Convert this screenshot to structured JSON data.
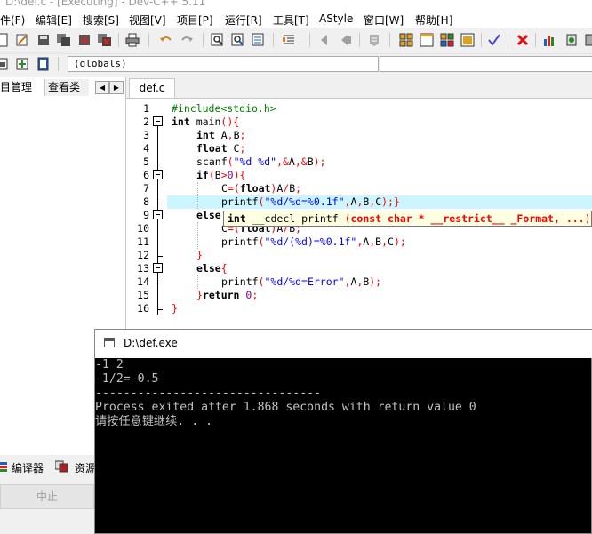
{
  "window": {
    "title": "D:\\def.c - [Executing] - Dev-C++ 5.11"
  },
  "menu": [
    "件(F)",
    "编辑[E]",
    "搜索[S]",
    "视图[V]",
    "项目[P]",
    "运行[R]",
    "工具[T]",
    "AStyle",
    "窗口[W]",
    "帮助[H]"
  ],
  "scope": {
    "value": "(globals)"
  },
  "left_panel": {
    "tab_project": "目管理",
    "tab_classes": "查看类",
    "prev": "◀",
    "next": "▶"
  },
  "bottom": {
    "tab_compiler": "编译器",
    "tab_resources": "资源",
    "abort_label": "中止"
  },
  "editor": {
    "tab": "def.c",
    "line_numbers": [
      "1",
      "2",
      "3",
      "4",
      "5",
      "6",
      "7",
      "8",
      "9",
      "10",
      "11",
      "12",
      "13",
      "14",
      "15",
      "16"
    ],
    "tooltip": "int __cdecl printf (const char * __restrict__ _Format, ...)",
    "tooltip_parts": {
      "ret": "int",
      "name": " __cdecl printf ",
      "open": "(",
      "args": "const char * __restrict__ _Format, ...",
      "close": ")"
    },
    "code": {
      "l1": "#include<stdio.h>",
      "l2a": "int",
      "l2b": " main",
      "l2c": "(){",
      "l3a": "int",
      "l3b": " A",
      "l3c": ",",
      "l3d": "B",
      "l3e": ";",
      "l4a": "float",
      "l4b": " C",
      "l4c": ";",
      "l5a": "scanf",
      "l5b": "(",
      "l5c": "\"%d %d\"",
      "l5d": ",&",
      "l5e": "A",
      "l5f": ",&",
      "l5g": "B",
      "l5h": ");",
      "l6a": "if",
      "l6b": "(",
      "l6c": "B",
      "l6d": ">",
      "l6e": "0",
      "l6f": "){",
      "l7a": "C",
      "l7b": "=(",
      "l7c": "float",
      "l7d": ")",
      "l7e": "A",
      "l7f": "/",
      "l7g": "B",
      "l7h": ";",
      "l8a": "printf",
      "l8b": "(",
      "l8c": "\"%d/%d=%0.1f\"",
      "l8d": ",",
      "l8e": "A",
      "l8f": ",",
      "l8g": "B",
      "l8h": ",",
      "l8i": "C",
      "l8j": ");}",
      "l9a": "else",
      "l10a": "C",
      "l10b": "=(",
      "l10c": "float",
      "l10d": ")",
      "l10e": "A",
      "l10f": "/",
      "l10g": "B",
      "l10h": ";",
      "l11a": "printf",
      "l11b": "(",
      "l11c": "\"%d/(%d)=%0.1f\"",
      "l11d": ",",
      "l11e": "A",
      "l11f": ",",
      "l11g": "B",
      "l11h": ",",
      "l11i": "C",
      "l11j": ");",
      "l12a": "}",
      "l13a": "else",
      "l13b": "{",
      "l14a": "printf",
      "l14b": "(",
      "l14c": "\"%d/%d=Error\"",
      "l14d": ",",
      "l14e": "A",
      "l14f": ",",
      "l14g": "B",
      "l14h": ");",
      "l15a": "}",
      "l15b": "return",
      "l15c": " 0",
      "l15d": ";",
      "l16a": "}"
    }
  },
  "console": {
    "title": "D:\\def.exe",
    "lines": [
      "-1 2",
      "-1/2=-0.5",
      "--------------------------------",
      "Process exited after 1.868 seconds with return value 0",
      "请按任意键继续. . ."
    ]
  },
  "colors": {
    "keyword": "#000000",
    "preprocessor": "#008000",
    "string": "#0000ff",
    "symbol": "#ff0000",
    "number": "#800080",
    "current_line": "#ccf5ff",
    "tooltip_bg": "#ffffe1",
    "console_bg": "#000000",
    "console_fg": "#c0c0c0"
  },
  "icons": {
    "toolbar1": [
      "new-file-icon",
      "open-file-icon",
      "save-icon",
      "save-all-icon",
      "close-file-icon",
      "close-all-icon",
      "print-icon",
      "undo-icon",
      "redo-icon",
      "find-icon",
      "replace-icon",
      "goto-line-icon",
      "indent-icon",
      "unindent-icon",
      "bookmark-icon",
      "comment-icon",
      "compile-icon",
      "run-icon",
      "compile-run-icon",
      "rebuild-icon",
      "check-icon",
      "stop-icon",
      "profile-icon",
      "debug-icon"
    ],
    "toolbar2": [
      "new-class-icon",
      "add-to-project-icon",
      "bookmark-doc-icon"
    ]
  }
}
